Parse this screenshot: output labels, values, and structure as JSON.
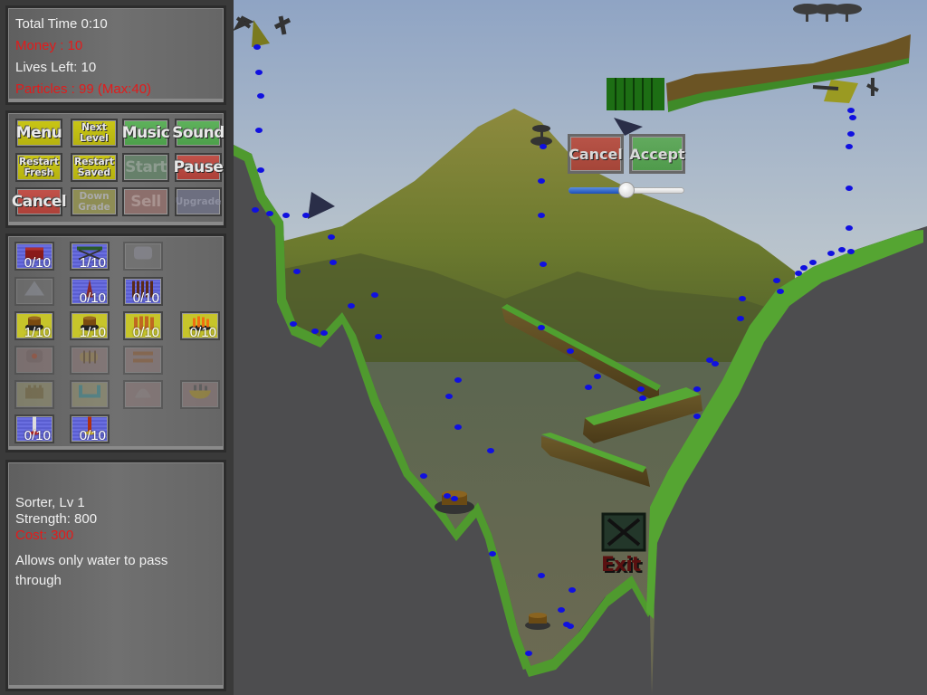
{
  "stats": {
    "total_time": "Total Time 0:10",
    "money": "Money : 10",
    "lives": "Lives Left: 10",
    "particles": "Particles : 99 (Max:40)"
  },
  "controls": [
    {
      "label": "Menu",
      "color": "yellow",
      "enabled": true,
      "size": "big"
    },
    {
      "label": "Next Level",
      "color": "yellow",
      "enabled": true,
      "size": "small"
    },
    {
      "label": "Music",
      "color": "green",
      "enabled": true,
      "size": "big"
    },
    {
      "label": "Sound",
      "color": "green",
      "enabled": true,
      "size": "big"
    },
    {
      "label": "Restart Fresh",
      "color": "yellow",
      "enabled": true,
      "size": "small"
    },
    {
      "label": "Restart Saved",
      "color": "yellow",
      "enabled": true,
      "size": "small"
    },
    {
      "label": "Start",
      "color": "green",
      "enabled": false,
      "size": "big"
    },
    {
      "label": "Pause",
      "color": "red",
      "enabled": true,
      "size": "big"
    },
    {
      "label": "Cancel",
      "color": "red",
      "enabled": true,
      "size": "big"
    },
    {
      "label": "Down Grade",
      "color": "yellow",
      "enabled": false,
      "size": "small"
    },
    {
      "label": "Sell",
      "color": "red",
      "enabled": false,
      "size": "big"
    },
    {
      "label": "Upgrade",
      "color": "blue",
      "enabled": false,
      "size": "small"
    }
  ],
  "towers": [
    {
      "name": "brick-block",
      "count": "0/10",
      "bg": "blue",
      "enabled": true,
      "icon": "block"
    },
    {
      "name": "scaffold",
      "count": "1/10",
      "bg": "blue",
      "enabled": true,
      "icon": "scaffold"
    },
    {
      "name": "metal-plate",
      "count": "",
      "bg": "grey",
      "enabled": false,
      "icon": "plate"
    },
    null,
    {
      "name": "pyramid",
      "count": "",
      "bg": "grey",
      "enabled": false,
      "icon": "pyramid"
    },
    {
      "name": "brick-spike",
      "count": "0/10",
      "bg": "blue",
      "enabled": true,
      "icon": "spike"
    },
    {
      "name": "spike-fence",
      "count": "0/10",
      "bg": "blue",
      "enabled": true,
      "icon": "fence"
    },
    null,
    {
      "name": "sorter-small",
      "count": "1/10",
      "bg": "yellow",
      "enabled": true,
      "icon": "sorter"
    },
    {
      "name": "sorter-large",
      "count": "1/10",
      "bg": "yellow",
      "enabled": true,
      "icon": "sorter"
    },
    {
      "name": "claw",
      "count": "0/10",
      "bg": "yellow",
      "enabled": true,
      "icon": "claw"
    },
    {
      "name": "fire-pit",
      "count": "0/10",
      "bg": "yellow",
      "enabled": true,
      "icon": "fire"
    },
    {
      "name": "furnace",
      "count": "",
      "bg": "pink",
      "enabled": false,
      "icon": "furnace"
    },
    {
      "name": "barrel-engine",
      "count": "",
      "bg": "pink",
      "enabled": false,
      "icon": "barrel"
    },
    {
      "name": "double-bar",
      "count": "",
      "bg": "pink",
      "enabled": false,
      "icon": "bars"
    },
    null,
    {
      "name": "castle-wall",
      "count": "",
      "bg": "khaki",
      "enabled": false,
      "icon": "castle"
    },
    {
      "name": "u-pipe",
      "count": "",
      "bg": "khaki",
      "enabled": false,
      "icon": "upipe"
    },
    {
      "name": "bell-dome",
      "count": "",
      "bg": "pink",
      "enabled": false,
      "icon": "dome"
    },
    {
      "name": "city-bowl",
      "count": "",
      "bg": "pink",
      "enabled": false,
      "icon": "bowl"
    },
    {
      "name": "white-pillar",
      "count": "0/10",
      "bg": "blue",
      "enabled": true,
      "icon": "pillar-white"
    },
    {
      "name": "red-pillar",
      "count": "0/10",
      "bg": "blue",
      "enabled": true,
      "icon": "pillar-red"
    }
  ],
  "info": {
    "title": "Sorter, Lv 1",
    "strength": "Strength: 800",
    "cost": "Cost: 300",
    "description": "Allows only water to pass through"
  },
  "popup": {
    "cancel_label": "Cancel",
    "accept_label": "Accept",
    "slider_value": 0.5
  },
  "scene": {
    "exit_label": "Exit",
    "particle_color": "#1010e0"
  }
}
